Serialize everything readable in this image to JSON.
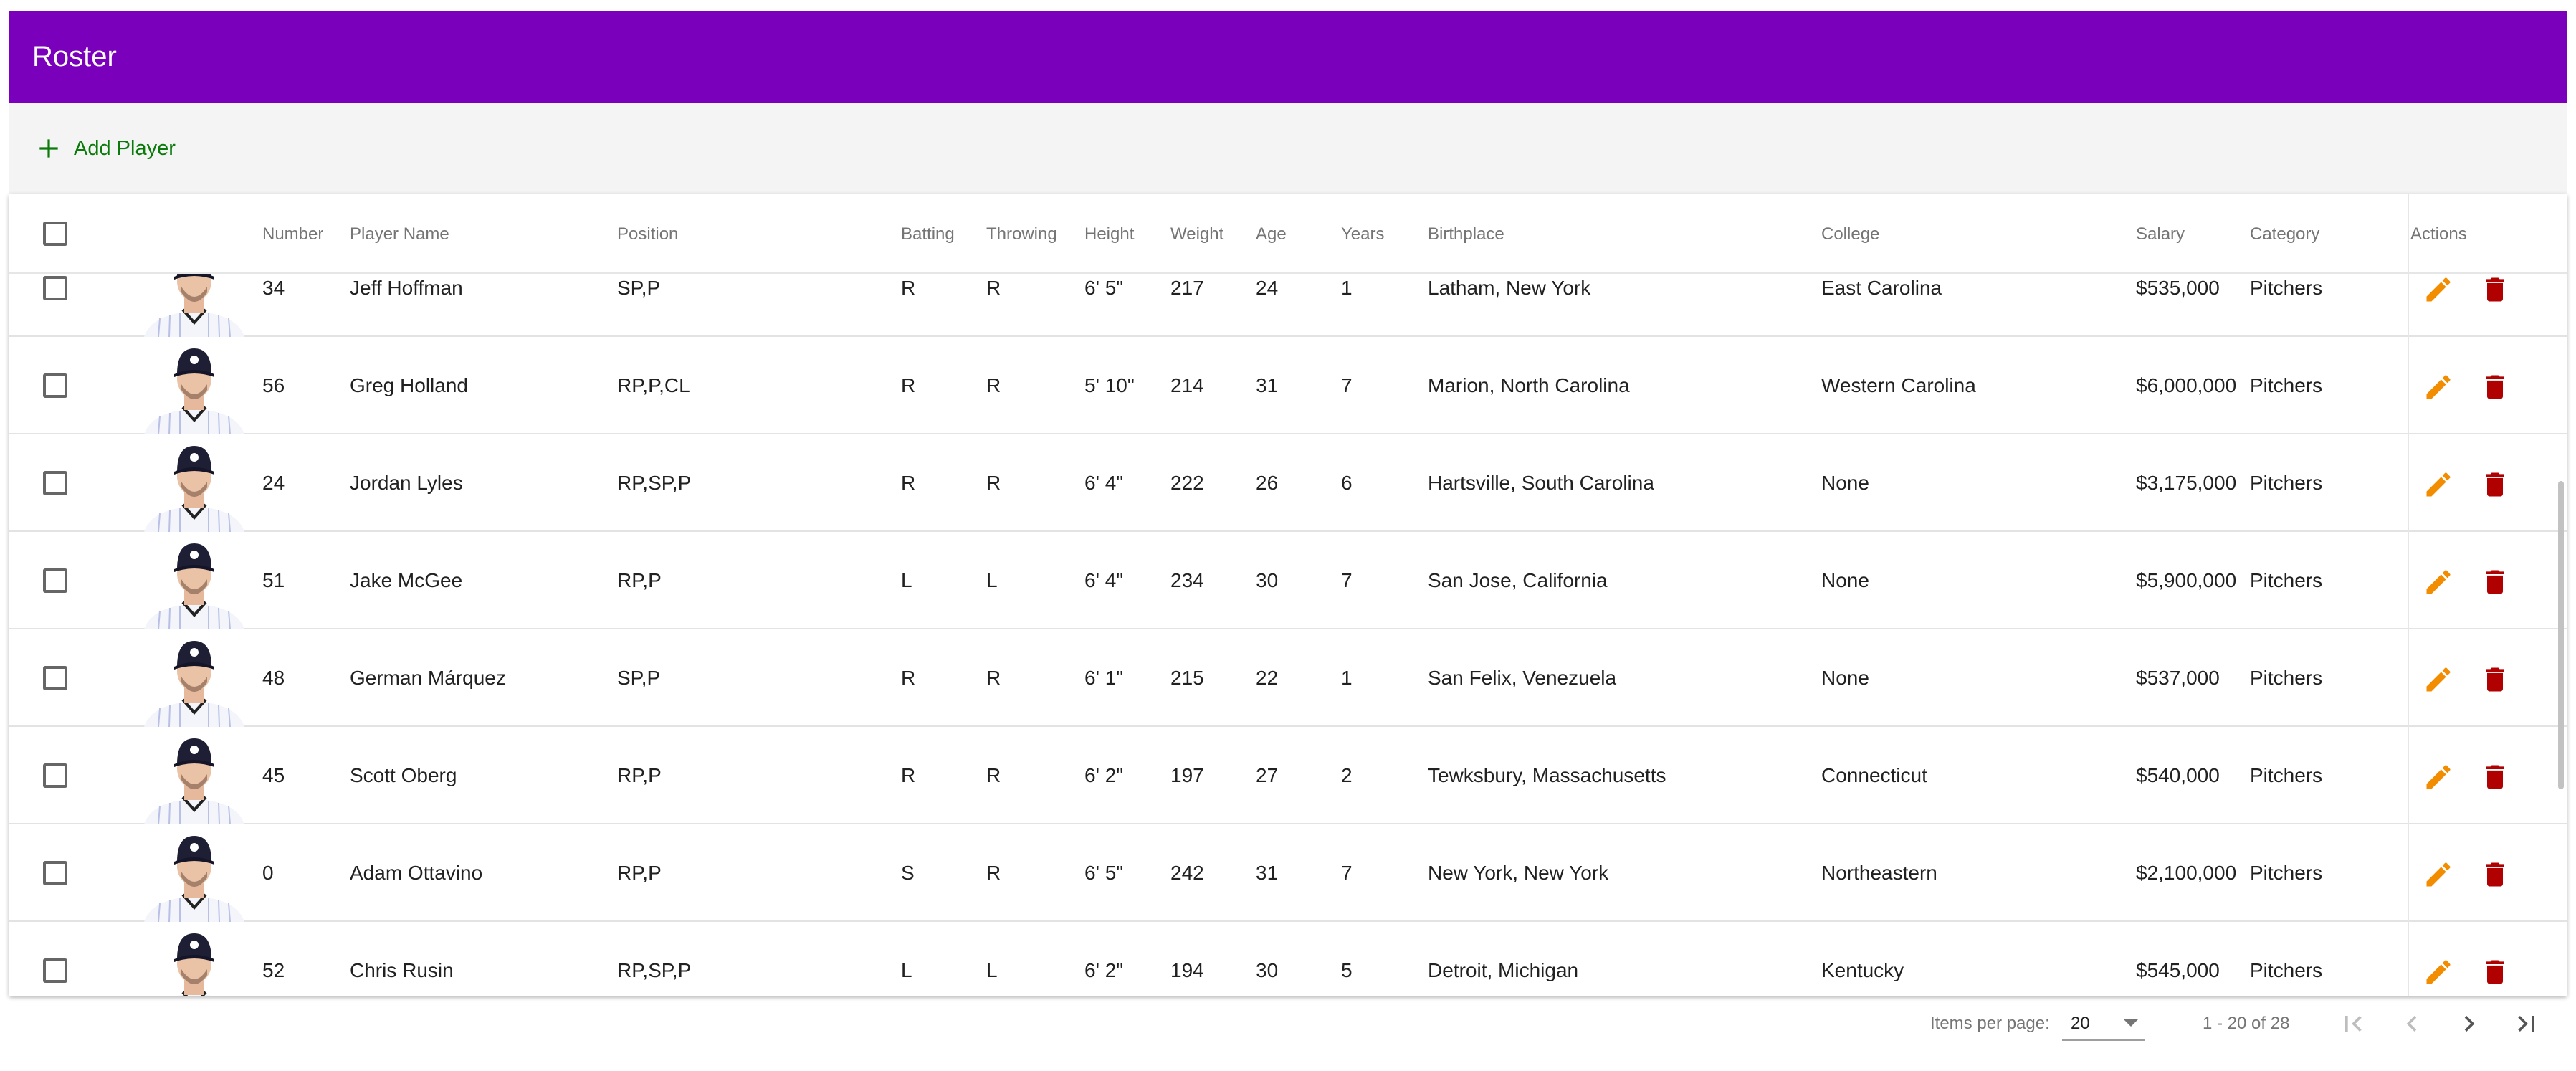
{
  "app": {
    "title": "Roster"
  },
  "toolbar": {
    "add_label": "Add Player"
  },
  "table": {
    "headers": {
      "number": "Number",
      "name": "Player Name",
      "position": "Position",
      "batting": "Batting",
      "throwing": "Throwing",
      "height": "Height",
      "weight": "Weight",
      "age": "Age",
      "years": "Years",
      "birthplace": "Birthplace",
      "college": "College",
      "salary": "Salary",
      "category": "Category",
      "actions": "Actions"
    },
    "rows": [
      {
        "number": "34",
        "name": "Jeff Hoffman",
        "position": "SP,P",
        "batting": "R",
        "throwing": "R",
        "height": "6' 5\"",
        "weight": "217",
        "age": "24",
        "years": "1",
        "birthplace": "Latham, New York",
        "college": "East Carolina",
        "salary": "$535,000",
        "category": "Pitchers"
      },
      {
        "number": "56",
        "name": "Greg Holland",
        "position": "RP,P,CL",
        "batting": "R",
        "throwing": "R",
        "height": "5' 10\"",
        "weight": "214",
        "age": "31",
        "years": "7",
        "birthplace": "Marion, North Carolina",
        "college": "Western Carolina",
        "salary": "$6,000,000",
        "category": "Pitchers"
      },
      {
        "number": "24",
        "name": "Jordan Lyles",
        "position": "RP,SP,P",
        "batting": "R",
        "throwing": "R",
        "height": "6' 4\"",
        "weight": "222",
        "age": "26",
        "years": "6",
        "birthplace": "Hartsville, South Carolina",
        "college": "None",
        "salary": "$3,175,000",
        "category": "Pitchers"
      },
      {
        "number": "51",
        "name": "Jake McGee",
        "position": "RP,P",
        "batting": "L",
        "throwing": "L",
        "height": "6' 4\"",
        "weight": "234",
        "age": "30",
        "years": "7",
        "birthplace": "San Jose, California",
        "college": "None",
        "salary": "$5,900,000",
        "category": "Pitchers"
      },
      {
        "number": "48",
        "name": "German Márquez",
        "position": "SP,P",
        "batting": "R",
        "throwing": "R",
        "height": "6' 1\"",
        "weight": "215",
        "age": "22",
        "years": "1",
        "birthplace": "San Felix, Venezuela",
        "college": "None",
        "salary": "$537,000",
        "category": "Pitchers"
      },
      {
        "number": "45",
        "name": "Scott Oberg",
        "position": "RP,P",
        "batting": "R",
        "throwing": "R",
        "height": "6' 2\"",
        "weight": "197",
        "age": "27",
        "years": "2",
        "birthplace": "Tewksbury, Massachusetts",
        "college": "Connecticut",
        "salary": "$540,000",
        "category": "Pitchers"
      },
      {
        "number": "0",
        "name": "Adam Ottavino",
        "position": "RP,P",
        "batting": "S",
        "throwing": "R",
        "height": "6' 5\"",
        "weight": "242",
        "age": "31",
        "years": "7",
        "birthplace": "New York, New York",
        "college": "Northeastern",
        "salary": "$2,100,000",
        "category": "Pitchers"
      },
      {
        "number": "52",
        "name": "Chris Rusin",
        "position": "RP,SP,P",
        "batting": "L",
        "throwing": "L",
        "height": "6' 2\"",
        "weight": "194",
        "age": "30",
        "years": "5",
        "birthplace": "Detroit, Michigan",
        "college": "Kentucky",
        "salary": "$545,000",
        "category": "Pitchers"
      }
    ]
  },
  "paginator": {
    "items_per_page_label": "Items per page:",
    "page_size": "20",
    "range": "1 - 20 of 28"
  },
  "colors": {
    "header": "#7b00bb",
    "add": "#0a7a0a",
    "edit": "#f28c00",
    "delete": "#b00000"
  },
  "icons": [
    "plus-icon",
    "pencil-icon",
    "trash-icon",
    "first-page-icon",
    "chevron-left-icon",
    "chevron-right-icon",
    "last-page-icon",
    "player-photo"
  ]
}
